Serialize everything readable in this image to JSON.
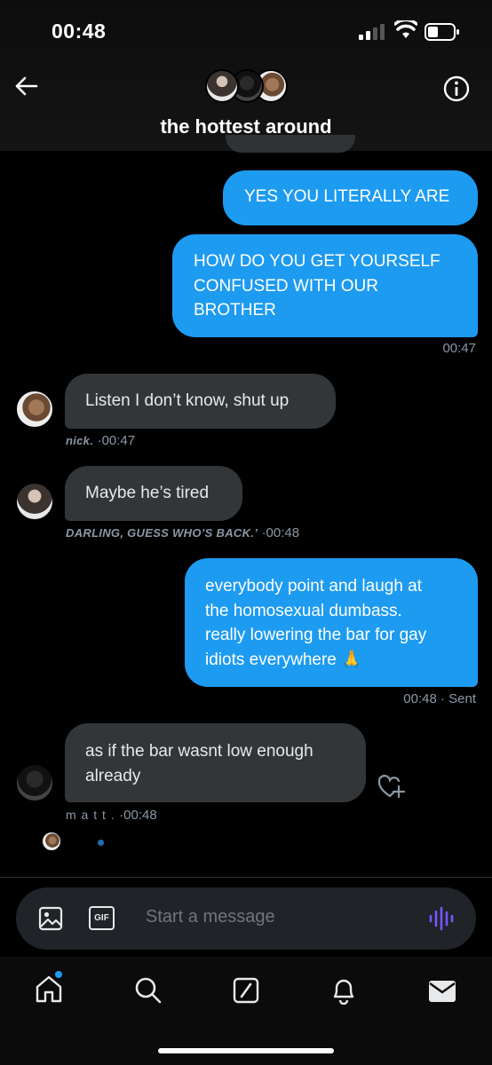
{
  "status": {
    "time": "00:48"
  },
  "header": {
    "title": "the hottest around"
  },
  "messages": {
    "m1": {
      "text": "YES YOU LITERALLY ARE"
    },
    "m2": {
      "line1": "HOW DO YOU GET YOURSELF",
      "line2": "CONFUSED WITH OUR",
      "line3": "BROTHER",
      "time": "00:47"
    },
    "m3": {
      "text": "Listen I don’t know, shut up",
      "sender": "nick.",
      "time": "·00:47"
    },
    "m4": {
      "text": "Maybe he’s tired",
      "sender": "DARLING, GUESS WHO’S BACK.’",
      "time": "·00:48"
    },
    "m5": {
      "line1": "everybody point and laugh at",
      "line2": "the homosexual dumbass.",
      "line3": "really lowering the bar for gay",
      "line4": "idiots everywhere 🙏",
      "time": "00:48 · Sent"
    },
    "m6": {
      "line1": "as if the bar wasnt low enough",
      "line2": "already",
      "sender": "m a t t .",
      "time": "·00:48"
    }
  },
  "composer": {
    "placeholder": "Start a message",
    "gif_label": "GIF"
  },
  "colors": {
    "accent": "#1d9bf0",
    "incoming": "#333639",
    "voice": "#7856ff"
  },
  "icons": [
    "back-arrow-icon",
    "info-icon",
    "image-icon",
    "gif-icon",
    "voice-icon",
    "home-icon",
    "search-icon",
    "grok-icon",
    "bell-icon",
    "mail-icon",
    "add-reaction-icon"
  ]
}
